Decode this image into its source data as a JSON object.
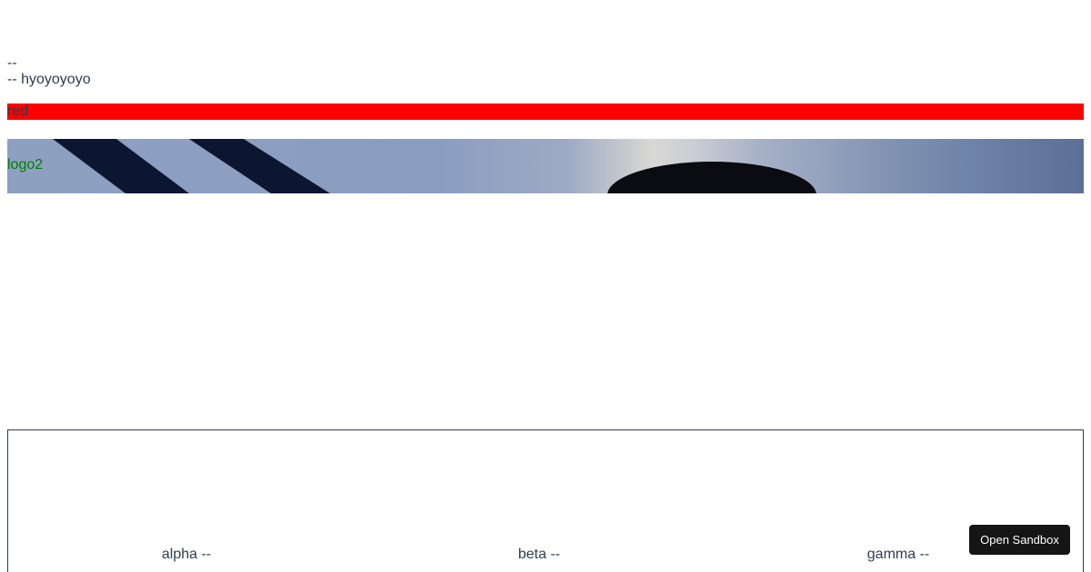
{
  "text": {
    "line1": "--",
    "line2": "-- hyoyoyoyo",
    "red_bar_label": "red",
    "logo_label": "logo2"
  },
  "panel": {
    "labels": [
      "alpha --",
      "beta --",
      "gamma --"
    ]
  },
  "sandbox_button": {
    "label": "Open Sandbox"
  },
  "colors": {
    "red_bar": "#ff0000",
    "logo_label": "#008000",
    "text": "#2c3e50",
    "button_bg": "#151515"
  }
}
